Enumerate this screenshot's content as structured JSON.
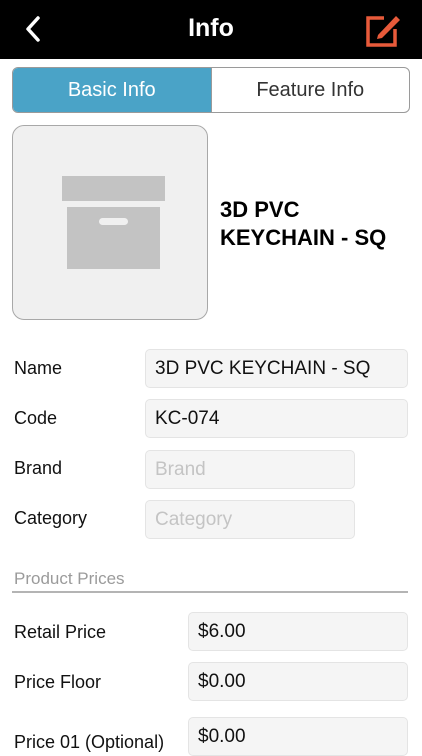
{
  "nav": {
    "title": "Info",
    "back_icon": "chevron-left-icon",
    "edit_icon": "edit-icon",
    "edit_color": "#e85a3a"
  },
  "tabs": [
    {
      "label": "Basic Info",
      "active": true
    },
    {
      "label": "Feature Info",
      "active": false
    }
  ],
  "product": {
    "title": "3D PVC KEYCHAIN - SQ",
    "image_icon": "archive-box-icon"
  },
  "fields": {
    "name": {
      "label": "Name",
      "value": "3D PVC KEYCHAIN - SQ"
    },
    "code": {
      "label": "Code",
      "value": "KC-074"
    },
    "brand": {
      "label": "Brand",
      "placeholder": "Brand"
    },
    "category": {
      "label": "Category",
      "placeholder": "Category"
    }
  },
  "prices": {
    "section_label": "Product Prices",
    "retail": {
      "label": "Retail Price",
      "value": "$6.00"
    },
    "floor": {
      "label": "Price Floor",
      "value": "$0.00"
    },
    "price01": {
      "label": "Price 01 (Optional)",
      "value": "$0.00"
    }
  },
  "colors": {
    "accent": "#4aa3c7",
    "navbar": "#000000"
  }
}
